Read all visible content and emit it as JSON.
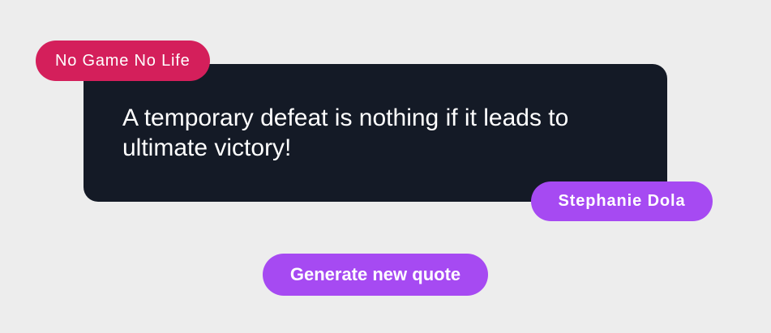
{
  "quote": {
    "text": "A temporary defeat is nothing if it leads to ultimate victory!",
    "anime": "No Game No Life",
    "character": "Stephanie Dola"
  },
  "actions": {
    "generate_label": "Generate new quote"
  },
  "colors": {
    "background": "#ededed",
    "card": "#141a26",
    "anime_badge": "#d41f5b",
    "accent": "#a64af2",
    "text": "#ffffff"
  }
}
